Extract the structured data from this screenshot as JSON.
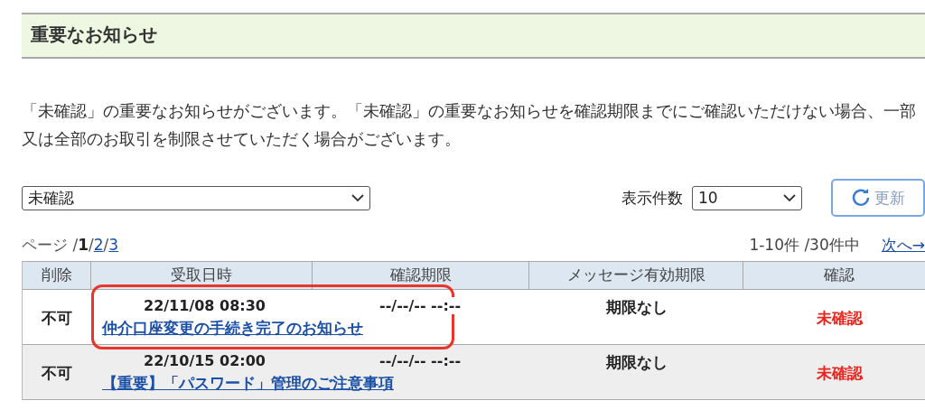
{
  "section_title": "重要なお知らせ",
  "notice": "「未確認」の重要なお知らせがございます。「未確認」の重要なお知らせを確認期限までにご確認いただけない場合、一部又は全部のお取引を制限させていただく場合がございます。",
  "status_filter": {
    "value": "未確認"
  },
  "per_page": {
    "label": "表示件数",
    "value": "10"
  },
  "refresh_button": "更新",
  "pagination": {
    "label": "ページ /",
    "separator": "/",
    "pages": [
      {
        "label": "1",
        "selected": true
      },
      {
        "label": "2",
        "selected": false
      },
      {
        "label": "3",
        "selected": false
      }
    ],
    "count": "1-10件 /30件中",
    "next": "次へ→"
  },
  "table": {
    "columns": [
      "削除",
      "受取日時",
      "確認期限",
      "メッセージ有効期限",
      "確認"
    ],
    "rows": [
      {
        "delete": "不可",
        "received": "22/11/08 08:30",
        "deadline": "--/--/-- --:--",
        "validity": "期限なし",
        "title": "仲介口座変更の手続き完了のお知らせ",
        "status": "未確認",
        "highlighted": true
      },
      {
        "delete": "不可",
        "received": "22/10/15 02:00",
        "deadline": "--/--/-- --:--",
        "validity": "期限なし",
        "title": "【重要】「パスワード」管理のご注意事項",
        "status": "未確認",
        "highlighted": false
      }
    ]
  }
}
